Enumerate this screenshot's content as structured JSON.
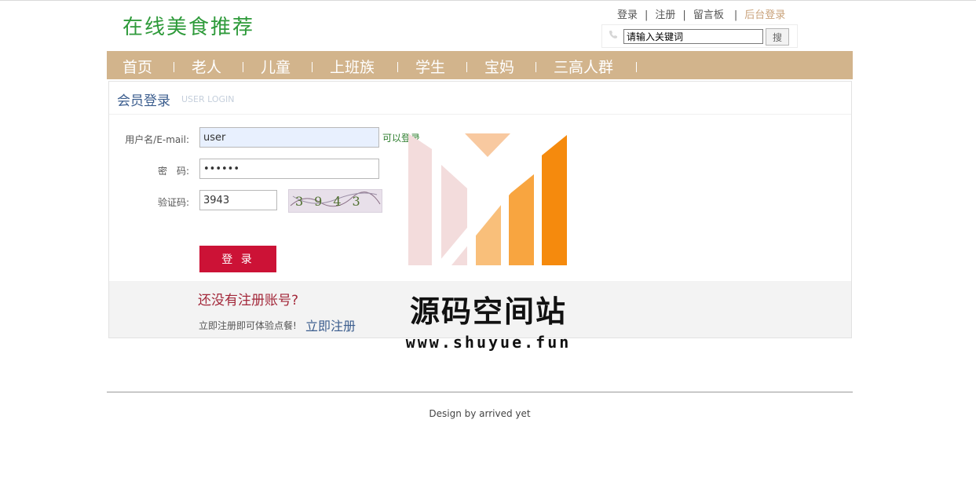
{
  "header": {
    "site_title": "在线美食推荐",
    "links": {
      "login": "登录",
      "register": "注册",
      "guestbook": "留言板",
      "admin_login": "后台登录"
    },
    "separator": "|"
  },
  "search": {
    "value": "请输入关键词",
    "button": "搜",
    "icon": "phone-icon"
  },
  "nav": {
    "items": [
      "首页",
      "老人",
      "儿童",
      "上班族",
      "学生",
      "宝妈",
      "三高人群"
    ],
    "bg_color": "#d2b48c"
  },
  "login": {
    "title": "会员登录",
    "subtitle": "USER LOGIN",
    "username_label": "用户名/E-mail:",
    "username_value": "user",
    "username_status": "可以登录",
    "password_label": "密　码:",
    "password_value": "••••••",
    "captcha_label": "验证码:",
    "captcha_value": "3943",
    "captcha_image_text": "3943",
    "submit": "登 录",
    "submit_color": "#cc1236"
  },
  "register_prompt": {
    "question": "还没有注册账号?",
    "hint": "立即注册即可体验点餐!",
    "link": "立即注册"
  },
  "watermark": {
    "name": "源码空间站",
    "url": "www.shuyue.fun"
  },
  "footer": {
    "text": "Design by arrived yet"
  }
}
